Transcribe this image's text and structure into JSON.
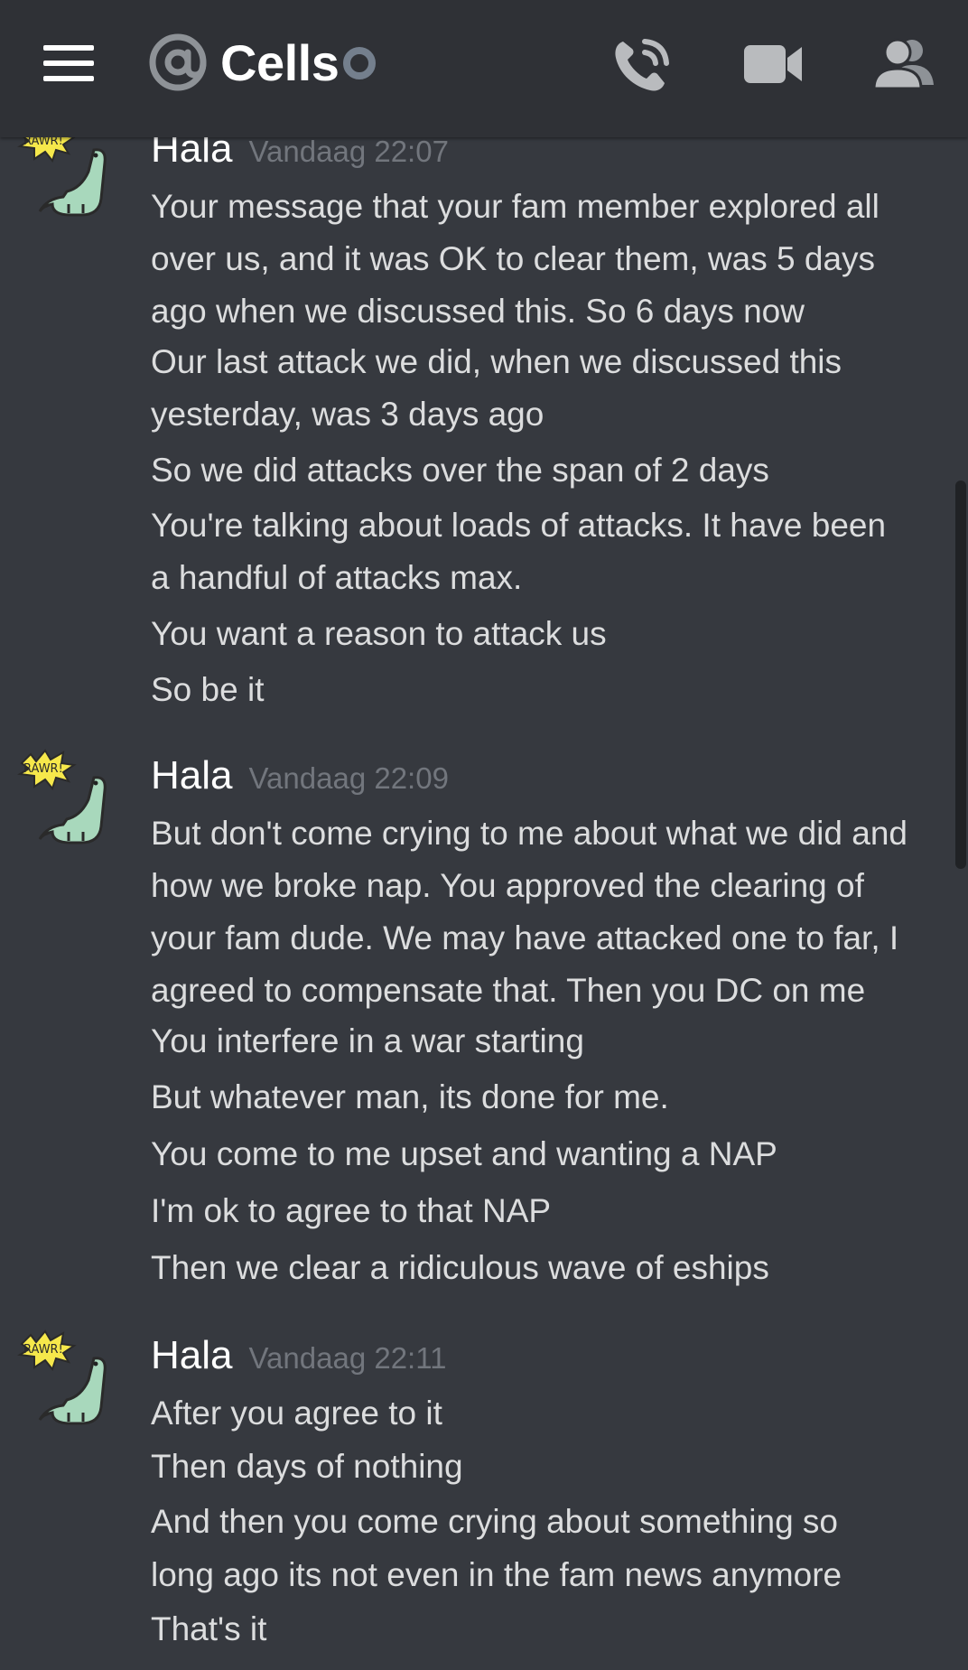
{
  "header": {
    "channel_name": "Cells",
    "colors": {
      "bar": "#2f3136",
      "icon": "#b9bbbe",
      "accent": "#ffffff"
    },
    "icons": [
      "menu-icon",
      "at-icon",
      "status-icon",
      "phone-call-icon",
      "video-camera-icon",
      "members-icon"
    ]
  },
  "messages": [
    {
      "author": "Hala",
      "timestamp": "Vandaag 22:07",
      "avatar_badge": "RAWR!",
      "lines": [
        "Your message that your fam member explored all",
        "over us, and it was OK to clear them, was 5 days",
        "ago when we discussed this. So 6 days now",
        "Our last attack we did, when we discussed this",
        "yesterday, was 3 days ago",
        "So we did attacks over the span of 2 days",
        "You're talking about loads of attacks. It have been",
        "a handful of attacks max.",
        "You want a reason to attack us",
        "So be it"
      ]
    },
    {
      "author": "Hala",
      "timestamp": "Vandaag 22:09",
      "avatar_badge": "RAWR!",
      "lines": [
        "But don't come crying to me about what we did and",
        "how we broke nap. You approved the clearing of",
        "your fam dude. We may have attacked one to far, I",
        "agreed to compensate that. Then you DC on me",
        "You interfere in a war starting",
        "But whatever man, its done for me.",
        "You come to me upset and wanting a NAP",
        "I'm ok to agree to that NAP",
        "Then we clear a ridiculous wave of eships"
      ]
    },
    {
      "author": "Hala",
      "timestamp": "Vandaag 22:11",
      "avatar_badge": "RAWR!",
      "lines": [
        "After you agree to it",
        "Then days of nothing",
        "And then you come crying about something so",
        "long ago its not even in the fam news anymore",
        "That's it"
      ]
    }
  ]
}
